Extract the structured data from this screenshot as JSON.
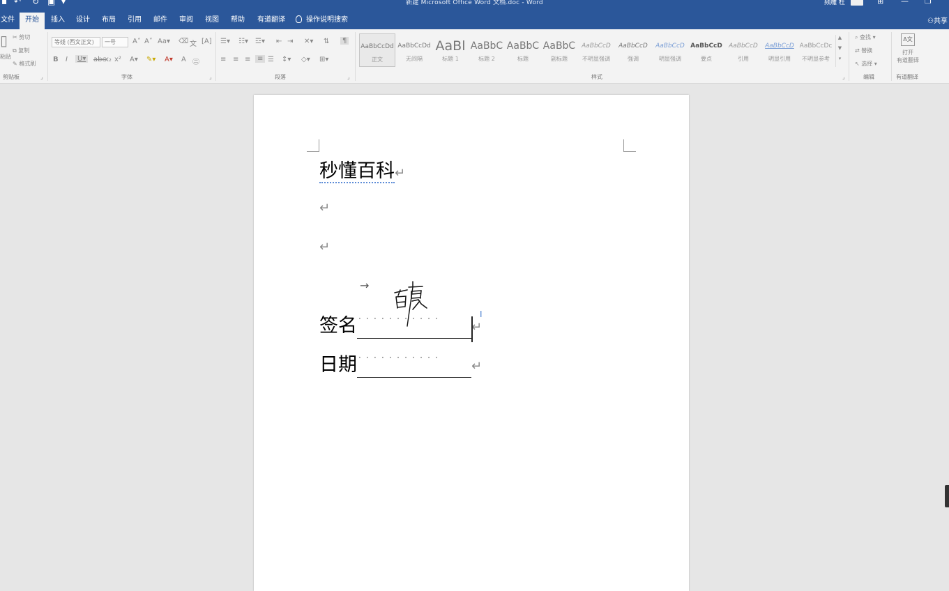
{
  "titlebar": {
    "title": "新建 Microsoft Office Word 文档.doc  -  Word",
    "user_name": "频雕 杜",
    "window_buttons": [
      "ribbon-display-icon",
      "minimize-icon",
      "restore-icon"
    ]
  },
  "tabs": [
    {
      "label": "文件",
      "active": false
    },
    {
      "label": "开始",
      "active": true
    },
    {
      "label": "插入",
      "active": false
    },
    {
      "label": "设计",
      "active": false
    },
    {
      "label": "布局",
      "active": false
    },
    {
      "label": "引用",
      "active": false
    },
    {
      "label": "邮件",
      "active": false
    },
    {
      "label": "审阅",
      "active": false
    },
    {
      "label": "视图",
      "active": false
    },
    {
      "label": "帮助",
      "active": false
    },
    {
      "label": "有道翻译",
      "active": false
    }
  ],
  "tell_me": "操作说明搜索",
  "share": "共享",
  "ribbon": {
    "clipboard": {
      "paste": "粘贴",
      "cut": "剪切",
      "copy": "复制",
      "format_painter": "格式刷",
      "label": "剪贴板"
    },
    "font": {
      "font_name": "等线 (西文正文)",
      "font_size": "一号",
      "label": "字体"
    },
    "paragraph": {
      "label": "段落"
    },
    "styles": {
      "label": "样式",
      "items": [
        {
          "preview": "AaBbCcDd",
          "name": "正文"
        },
        {
          "preview": "AaBbCcDd",
          "name": "无间隔"
        },
        {
          "preview": "AaBl",
          "name": "标题 1"
        },
        {
          "preview": "AaBbC",
          "name": "标题 2"
        },
        {
          "preview": "AaBbC",
          "name": "标题"
        },
        {
          "preview": "AaBbC",
          "name": "副标题"
        },
        {
          "preview": "AaBbCcD",
          "name": "不明显强调"
        },
        {
          "preview": "AaBbCcD",
          "name": "强调"
        },
        {
          "preview": "AaBbCcD",
          "name": "明显强调"
        },
        {
          "preview": "AaBbCcD",
          "name": "要点"
        },
        {
          "preview": "AaBbCcD",
          "name": "引用"
        },
        {
          "preview": "AaBbCcD",
          "name": "明显引用"
        },
        {
          "preview": "AaBbCcDc",
          "name": "不明显参考"
        }
      ]
    },
    "editing": {
      "find": "查找",
      "replace": "替换",
      "select": "选择",
      "label": "编辑"
    },
    "youdao": {
      "open": "打开",
      "open2": "有道翻译",
      "label": "有道翻译"
    }
  },
  "document": {
    "title_line": "秒懂百科",
    "paragraph_mark": "↵",
    "tab_arrow": "→",
    "sign_label": "签名",
    "date_label": "日期",
    "dots": "···········"
  },
  "colors": {
    "titlebar": "#2b579a",
    "ribbon": "#f3f3f3",
    "workspace": "#e6e6e6",
    "page": "#ffffff"
  }
}
